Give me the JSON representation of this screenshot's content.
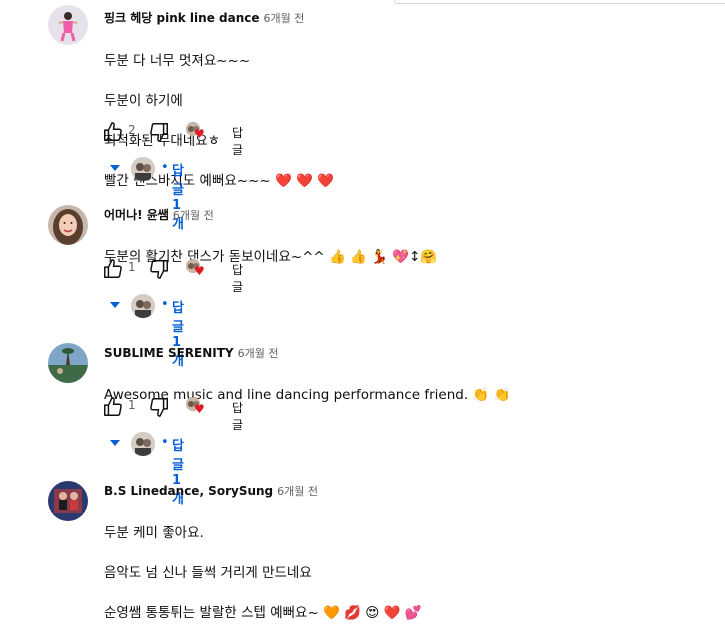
{
  "comments": [
    {
      "author": "핑크 헤당 pink line dance",
      "time": "6개월 전",
      "lines": [
        "두분 다 너무 멋져요~~~",
        "두분이 하기에",
        "최적화된 무대네요ㅎ",
        "빨간 댄스바지도  예뻐요~~~ ❤️ ❤️ ❤️"
      ],
      "likes": "2",
      "reply_label": "답글",
      "replies_label": "답글 1개",
      "dot": "•"
    },
    {
      "author": "어머나! 윤쌤",
      "time": "6개월 전",
      "lines": [
        "두분의 활기찬 댄스가 돋보이네요~^^ 👍 👍 💃 💖↕🤗"
      ],
      "likes": "1",
      "reply_label": "답글",
      "replies_label": "답글 1개",
      "dot": "•"
    },
    {
      "author": "SUBLIME SERENITY",
      "time": "6개월 전",
      "lines": [
        "Awesome music and line dancing performance friend. 👏 👏"
      ],
      "likes": "1",
      "reply_label": "답글",
      "replies_label": "답글 1개",
      "dot": "•"
    },
    {
      "author": "B.S Linedance, SorySung",
      "time": "6개월 전",
      "lines": [
        "두분 케미 좋아요.",
        "음악도 넘 신나 들썩 거리게 만드네요",
        "순영쌤 통통튀는 발랄한 스텝 예뻐요~ 🧡 💋 😍 ❤️ 💕"
      ]
    }
  ],
  "icons": {
    "like": "thumbs-up-icon",
    "dislike": "thumbs-down-icon",
    "hearted": "creator-heart-icon",
    "expand": "caret-down-icon"
  },
  "colors": {
    "link": "#065fd4",
    "heart": "#e01b24",
    "secondary_text": "#606060"
  }
}
